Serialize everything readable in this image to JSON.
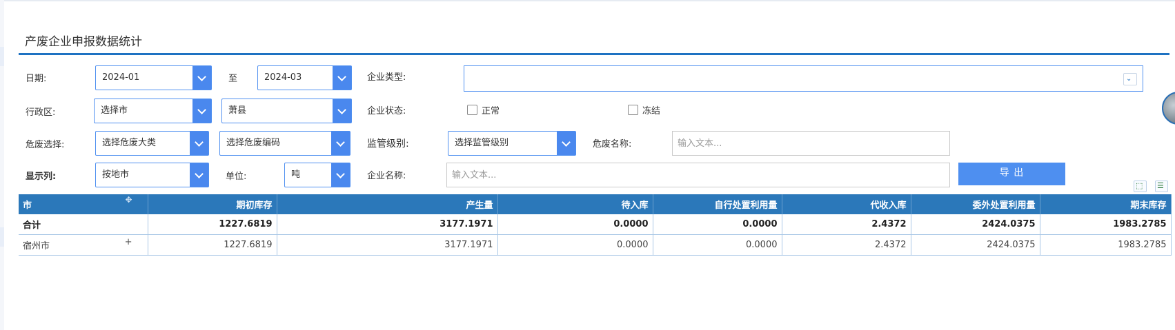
{
  "panel": {
    "title": "产废企业申报数据统计"
  },
  "filters": {
    "date_label": "日期:",
    "date_from": "2024-01",
    "date_to_label": "至",
    "date_to": "2024-03",
    "company_type_label": "企业类型:",
    "company_type_value": "",
    "region_label": "行政区:",
    "city_select": "选择市",
    "county_select": "萧县",
    "status_label": "企业状态:",
    "status_options": [
      "正常",
      "冻结"
    ],
    "hazard_label": "危废选择:",
    "hazard_category_select": "选择危废大类",
    "hazard_code_select": "选择危废编码",
    "supervision_label": "监管级别:",
    "supervision_select": "选择监管级别",
    "hazard_name_label": "危废名称:",
    "hazard_name_placeholder": "输入文本...",
    "display_label": "显示列:",
    "display_select": "按地市",
    "unit_label": "单位:",
    "unit_select": "吨",
    "company_name_label": "企业名称:",
    "company_name_placeholder": "输入文本...",
    "export_label": "导 出"
  },
  "table": {
    "headers": [
      "市",
      "期初库存",
      "产生量",
      "待入库",
      "自行处置利用量",
      "代收入库",
      "委外处置利用量",
      "期末库存"
    ],
    "total_row": [
      "合计",
      "1227.6819",
      "3177.1971",
      "0.0000",
      "0.0000",
      "2.4372",
      "2424.0375",
      "1983.2785"
    ],
    "rows": [
      [
        "宿州市",
        "1227.6819",
        "3177.1971",
        "0.0000",
        "0.0000",
        "2.4372",
        "2424.0375",
        "1983.2785"
      ]
    ],
    "expand_symbol": "+"
  },
  "icons": {
    "expand_more": "double-chevron-down-icon",
    "tool_1": "select-region-icon",
    "tool_2": "column-list-icon"
  },
  "colors": {
    "accent": "#4a88ee",
    "header": "#2b78ba",
    "rule": "#1e72c2"
  }
}
